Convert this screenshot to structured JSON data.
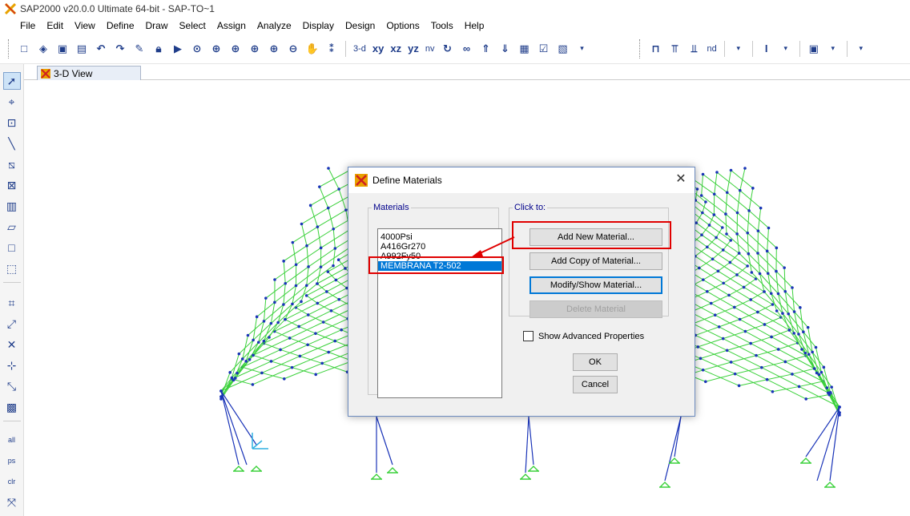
{
  "window": {
    "title": "SAP2000 v20.0.0 Ultimate 64-bit - SAP-TO~1"
  },
  "menu": [
    "File",
    "Edit",
    "View",
    "Define",
    "Draw",
    "Select",
    "Assign",
    "Analyze",
    "Display",
    "Design",
    "Options",
    "Tools",
    "Help"
  ],
  "toolbar": {
    "view_3d": "3-d",
    "view_xy": "xy",
    "view_xz": "xz",
    "view_yz": "yz",
    "view_nv": "nv",
    "view_nd": "nd"
  },
  "tab": {
    "label": "3-D View"
  },
  "left_toolbar": {
    "labels": [
      "all",
      "ps",
      "clr"
    ]
  },
  "dialog": {
    "title": "Define Materials",
    "materials_legend": "Materials",
    "clickto_legend": "Click to:",
    "materials": [
      "4000Psi",
      "A416Gr270",
      "A992Fy50",
      "MEMBRANA T2-502"
    ],
    "selected_material": "MEMBRANA T2-502",
    "buttons": {
      "add_new": "Add New Material...",
      "add_copy": "Add Copy of Material...",
      "modify_show": "Modify/Show Material...",
      "delete": "Delete Material",
      "ok": "OK",
      "cancel": "Cancel"
    },
    "show_advanced_label": "Show Advanced Properties",
    "show_advanced_checked": false
  },
  "colors": {
    "mesh_green": "#3bd13b",
    "node_blue": "#1a34b8",
    "selection_blue": "#0078d7",
    "annotation_red": "#e00000"
  }
}
